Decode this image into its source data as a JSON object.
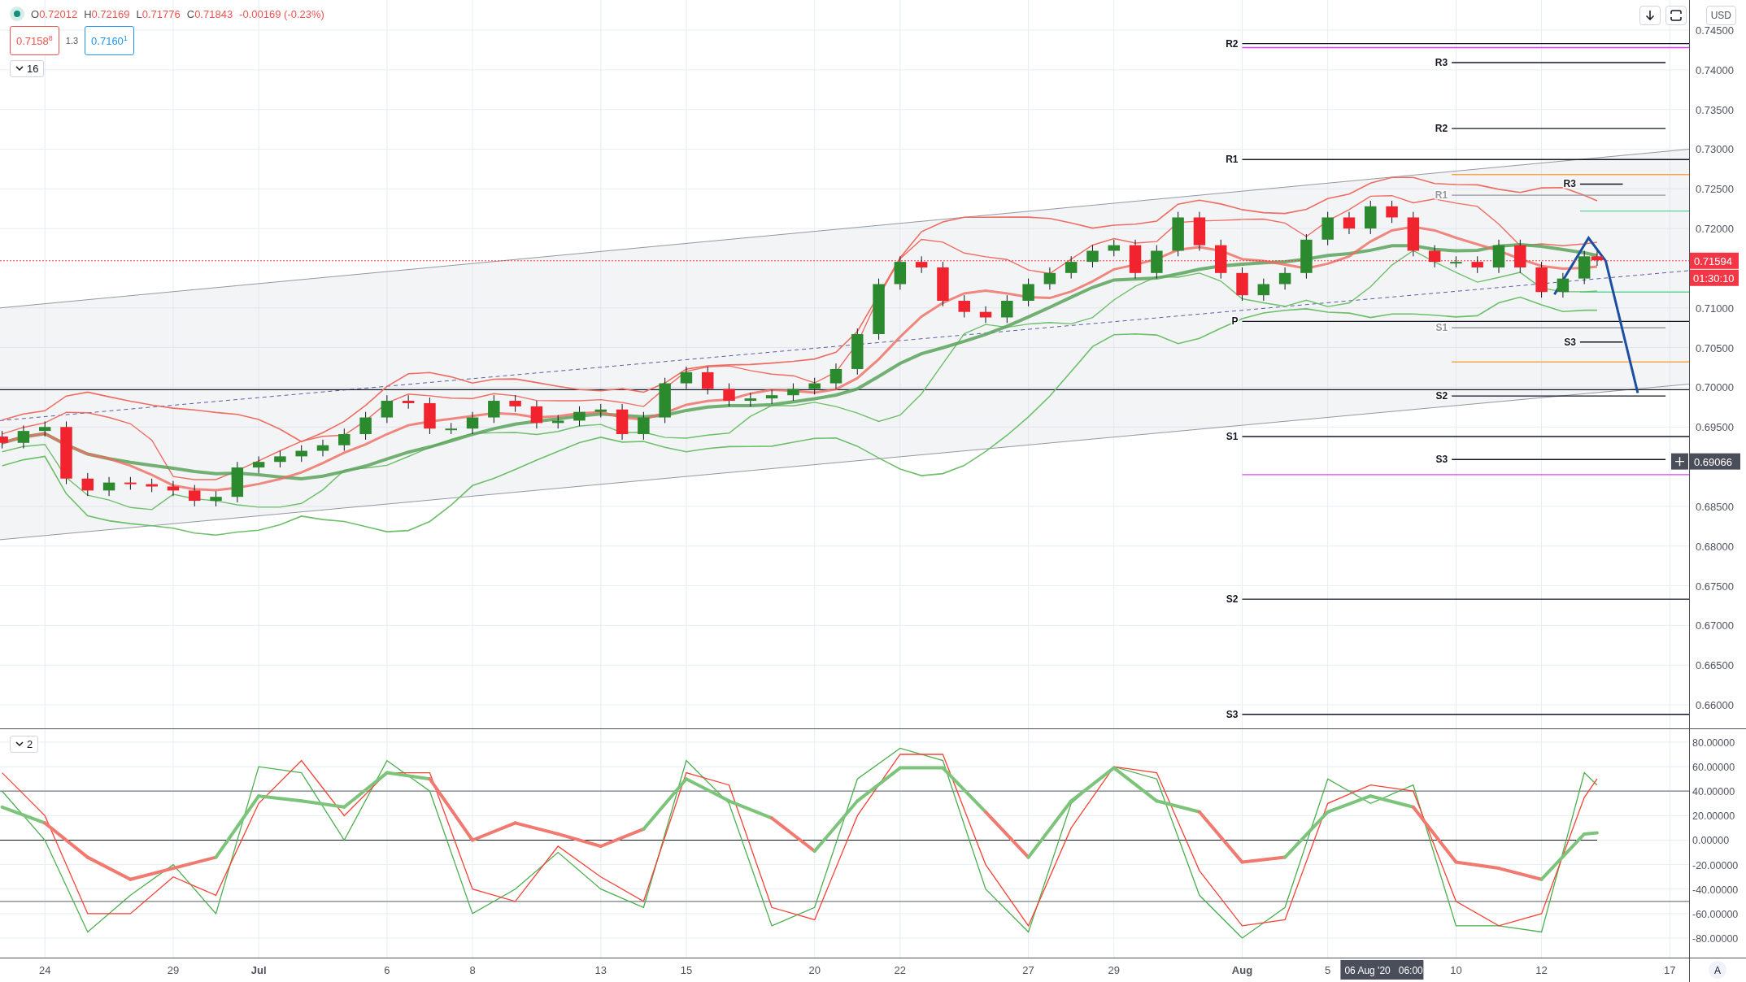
{
  "legend": {
    "ohlc": [
      {
        "label": "O",
        "value": "0.72012"
      },
      {
        "label": "H",
        "value": "0.72169"
      },
      {
        "label": "L",
        "value": "0.71776"
      },
      {
        "label": "C",
        "value": "0.71843"
      }
    ],
    "change": "-0.00169 (-0.23%)",
    "bid": "0.7158$^{8}$",
    "spread": "1.3",
    "ask": "0.7160$^{1}$",
    "indicators_toggle": "16"
  },
  "toolbar": {
    "currency": "USD"
  },
  "price_chart": {
    "last_price": "0.71594",
    "countdown": "01:30:10",
    "crosshair_price": "0.69066",
    "axis_labels": [
      "0.74500",
      "0.74000",
      "0.73500",
      "0.73000",
      "0.72500",
      "0.72000",
      "0.71000",
      "0.70500",
      "0.70000",
      "0.69500",
      "0.68500",
      "0.68000",
      "0.67500",
      "0.67000",
      "0.66500",
      "0.66000"
    ],
    "pivot_labels": [
      {
        "label": "R2",
        "faint": false
      },
      {
        "label": "R1",
        "faint": false
      },
      {
        "label": "P",
        "faint": false
      },
      {
        "label": "S1",
        "faint": false
      },
      {
        "label": "S2",
        "faint": false
      },
      {
        "label": "S3",
        "faint": false
      },
      {
        "label": "R3",
        "faint": false
      },
      {
        "label": "R2",
        "faint": false
      },
      {
        "label": "R1",
        "faint": true
      },
      {
        "label": "S1",
        "faint": true
      },
      {
        "label": "S2",
        "faint": false
      },
      {
        "label": "S3",
        "faint": false
      },
      {
        "label": "R3",
        "faint": false
      },
      {
        "label": "S3",
        "faint": false
      }
    ]
  },
  "oscillator": {
    "indicators_toggle": "2",
    "axis_labels": [
      "80.00000",
      "60.00000",
      "40.00000",
      "20.00000",
      "0.00000",
      "-20.00000",
      "-40.00000",
      "-60.00000",
      "-80.00000"
    ]
  },
  "time_axis": {
    "labels": [
      {
        "label": "24",
        "month": false
      },
      {
        "label": "29",
        "month": false
      },
      {
        "label": "Jul",
        "month": true
      },
      {
        "label": "6",
        "month": false
      },
      {
        "label": "8",
        "month": false
      },
      {
        "label": "13",
        "month": false
      },
      {
        "label": "15",
        "month": false
      },
      {
        "label": "20",
        "month": false
      },
      {
        "label": "22",
        "month": false
      },
      {
        "label": "27",
        "month": false
      },
      {
        "label": "29",
        "month": false
      },
      {
        "label": "Aug",
        "month": true
      },
      {
        "label": "5",
        "month": false
      },
      {
        "label": "10",
        "month": false
      },
      {
        "label": "12",
        "month": false
      },
      {
        "label": "17",
        "month": false
      }
    ],
    "crosshair_date": "06 Aug '20",
    "crosshair_time": "06:00",
    "auto_scale": "A"
  }
}
